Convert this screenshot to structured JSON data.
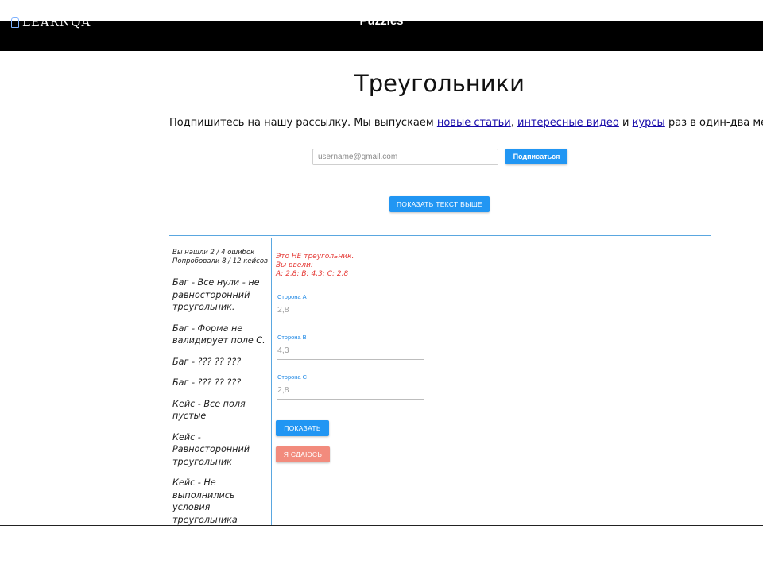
{
  "nav": {
    "logo": "LEARNQA",
    "title": "Puzzles"
  },
  "page": {
    "title": "Треугольники"
  },
  "subscribe": {
    "text_before": "Подпишитесь на нашу рассылку. Мы выпускаем ",
    "link1": "новые статьи",
    "sep1": ", ",
    "link2": "интересные видео",
    "sep2": " и ",
    "link3": "курсы",
    "text_after": " раз в один-два месяца.",
    "placeholder": "username@gmail.com",
    "button": "Подписаться"
  },
  "show_text_button": "ПОКАЗАТЬ ТЕКСТ ВЫШЕ",
  "sidebar": {
    "stats_line1": "Вы нашли 2 / 4 ошибок",
    "stats_line2": "Попробовали 8 / 12 кейсов",
    "items": [
      "Баг - Все нули - не равносторонний треугольник.",
      "Баг - Форма не валидирует поле С.",
      "Баг - ??? ?? ???",
      "Баг - ??? ?? ???",
      "Кейс - Все поля пустые",
      "Кейс - Равносторонний треугольник",
      "Кейс - Не выполнились условия треугольника"
    ]
  },
  "result": {
    "line1": "Это НЕ треугольник.",
    "line2": "Вы ввели:",
    "line3": "A: 2,8; B: 4,3; C: 2,8"
  },
  "fields": [
    {
      "label": "Сторона А",
      "value": "2,8"
    },
    {
      "label": "Сторона В",
      "value": "4,3"
    },
    {
      "label": "Сторона С",
      "value": "2,8"
    }
  ],
  "buttons": {
    "show": "ПОКАЗАТЬ",
    "give_up": "Я СДАЮСЬ"
  },
  "colors": {
    "accent": "#2196f3",
    "error": "#e53935",
    "give_up": "#f28b7d",
    "nav_bg": "#000000"
  }
}
